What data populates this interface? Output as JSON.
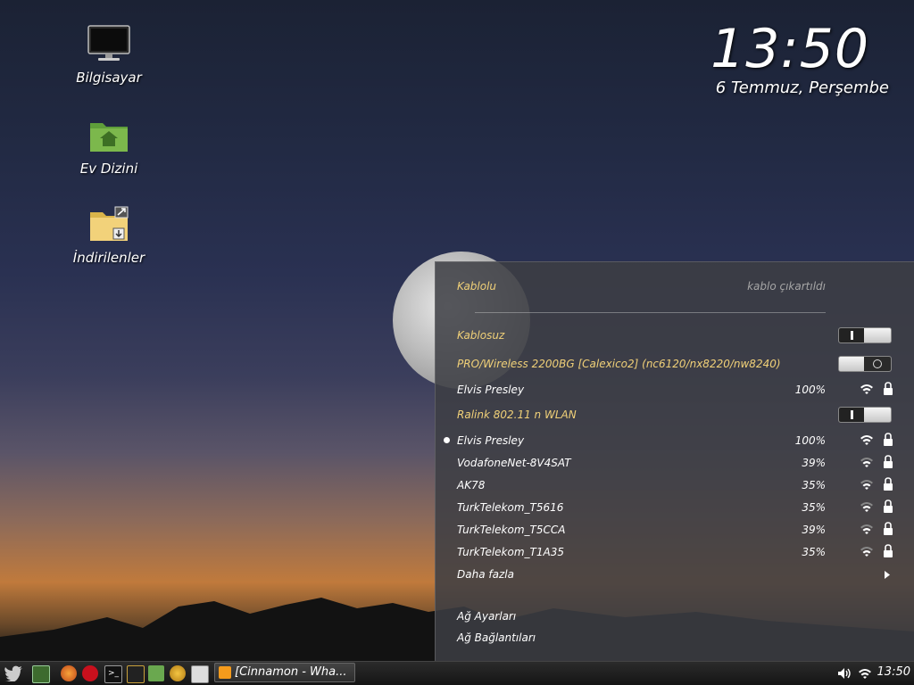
{
  "desktop": {
    "icons": [
      {
        "label": "Bilgisayar",
        "icon": "computer-icon"
      },
      {
        "label": "Ev Dizini",
        "icon": "home-folder-icon"
      },
      {
        "label": "İndirilenler",
        "icon": "downloads-folder-icon"
      }
    ]
  },
  "clock": {
    "time": "13:50",
    "date": "6 Temmuz, Perşembe"
  },
  "network_menu": {
    "wired": {
      "label": "Kablolu",
      "status": "kablo çıkartıldı"
    },
    "wireless": {
      "label": "Kablosuz",
      "enabled": true
    },
    "adapters": [
      {
        "label": "PRO/Wireless 2200BG [Calexico2] (nc6120/nx8220/nw8240)",
        "enabled": false,
        "networks": [
          {
            "name": "Elvis Presley",
            "signal": "100%",
            "secured": true,
            "connected": false
          }
        ]
      },
      {
        "label": "Ralink 802.11 n WLAN",
        "enabled": true,
        "networks": [
          {
            "name": "Elvis Presley",
            "signal": "100%",
            "secured": true,
            "connected": true
          },
          {
            "name": "VodafoneNet-8V4SAT",
            "signal": "39%",
            "secured": true,
            "connected": false
          },
          {
            "name": "AK78",
            "signal": "35%",
            "secured": true,
            "connected": false
          },
          {
            "name": "TurkTelekom_T5616",
            "signal": "35%",
            "secured": true,
            "connected": false
          },
          {
            "name": "TurkTelekom_T5CCA",
            "signal": "39%",
            "secured": true,
            "connected": false
          },
          {
            "name": "TurkTelekom_T1A35",
            "signal": "35%",
            "secured": true,
            "connected": false
          }
        ]
      }
    ],
    "more_label": "Daha fazla",
    "settings_label": "Ağ Ayarları",
    "connections_label": "Ağ Bağlantıları"
  },
  "taskbar": {
    "launchers": [
      "twitter-icon",
      "show-desktop-icon",
      "firefox-icon",
      "opera-icon",
      "terminal-icon",
      "system-monitor-icon",
      "files-icon",
      "pidgin-icon",
      "screenshot-icon"
    ],
    "window_title": "[Cinnamon - Wha...",
    "tray": {
      "time": "13:50"
    }
  },
  "colors": {
    "accent": "#f0d078",
    "panel_bg": "#3c3e44"
  }
}
